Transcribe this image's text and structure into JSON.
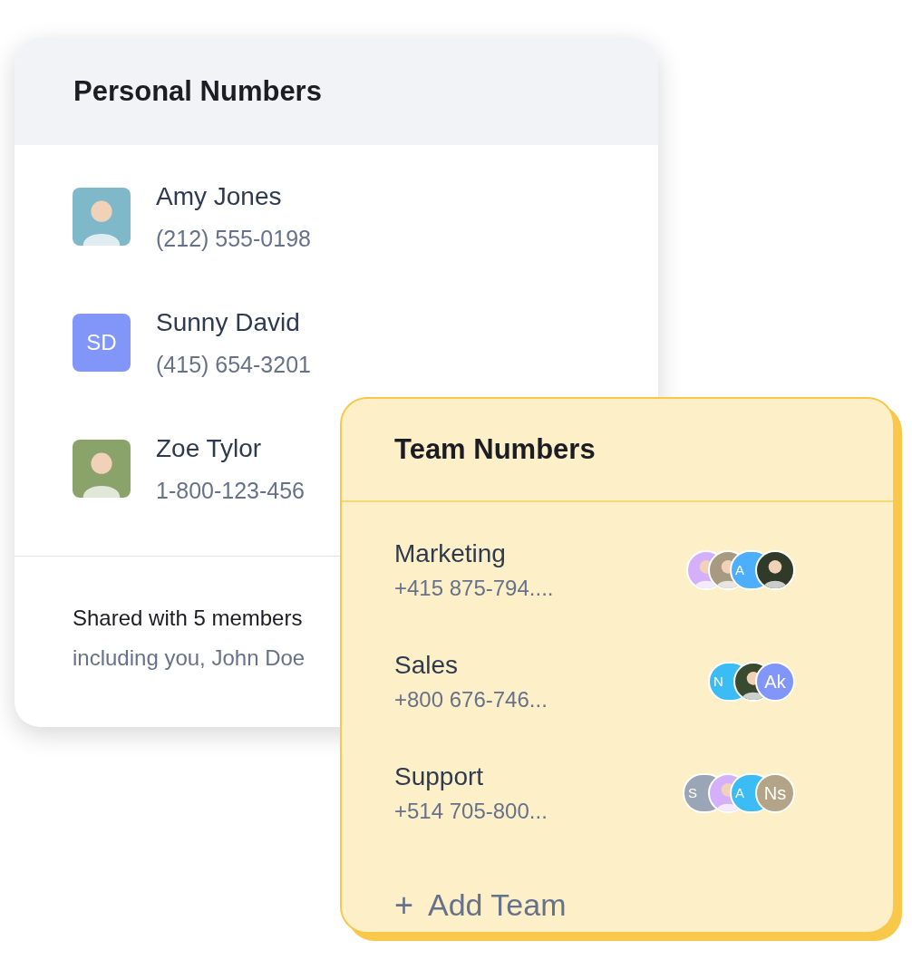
{
  "personal_card": {
    "title": "Personal Numbers",
    "contacts": [
      {
        "name": "Amy Jones",
        "number": "(212) 555-0198",
        "avatar": {
          "kind": "photo",
          "color": "#7fb8c8"
        }
      },
      {
        "name": "Sunny David",
        "number": "(415) 654-3201",
        "avatar": {
          "kind": "initials",
          "initials": "SD",
          "color": "#8196f8"
        }
      },
      {
        "name": "Zoe Tylor",
        "number": "1-800-123-456",
        "avatar": {
          "kind": "photo",
          "color": "#8aa36a"
        }
      }
    ],
    "footer": {
      "shared": "Shared with 5 members",
      "including": "including you, John Doe"
    }
  },
  "team_card": {
    "title": "Team Numbers",
    "teams": [
      {
        "name": "Marketing",
        "number": "+415 875-794....",
        "members": [
          {
            "kind": "photo",
            "color": "#d4b0fa"
          },
          {
            "kind": "photo",
            "color": "#a89a80"
          },
          {
            "kind": "initials",
            "initials": "A",
            "color": "#4daffa"
          },
          {
            "kind": "photo",
            "color": "#2f3a28"
          }
        ]
      },
      {
        "name": "Sales",
        "number": "+800 676-746...",
        "members": [
          {
            "kind": "initials",
            "initials": "N",
            "color": "#3bbcf5"
          },
          {
            "kind": "photo",
            "color": "#3a4a30"
          },
          {
            "kind": "initials",
            "initials": "Ak",
            "color": "#8196f8"
          }
        ]
      },
      {
        "name": "Support",
        "number": "+514 705-800...",
        "members": [
          {
            "kind": "initials",
            "initials": "S",
            "color": "#9aa5b5"
          },
          {
            "kind": "photo",
            "color": "#d4b0fa"
          },
          {
            "kind": "initials",
            "initials": "A",
            "color": "#3bbcf5"
          },
          {
            "kind": "initials",
            "initials": "Ns",
            "color": "#b3a487"
          }
        ]
      }
    ],
    "add_button": {
      "icon": "+",
      "label": "Add Team"
    }
  }
}
